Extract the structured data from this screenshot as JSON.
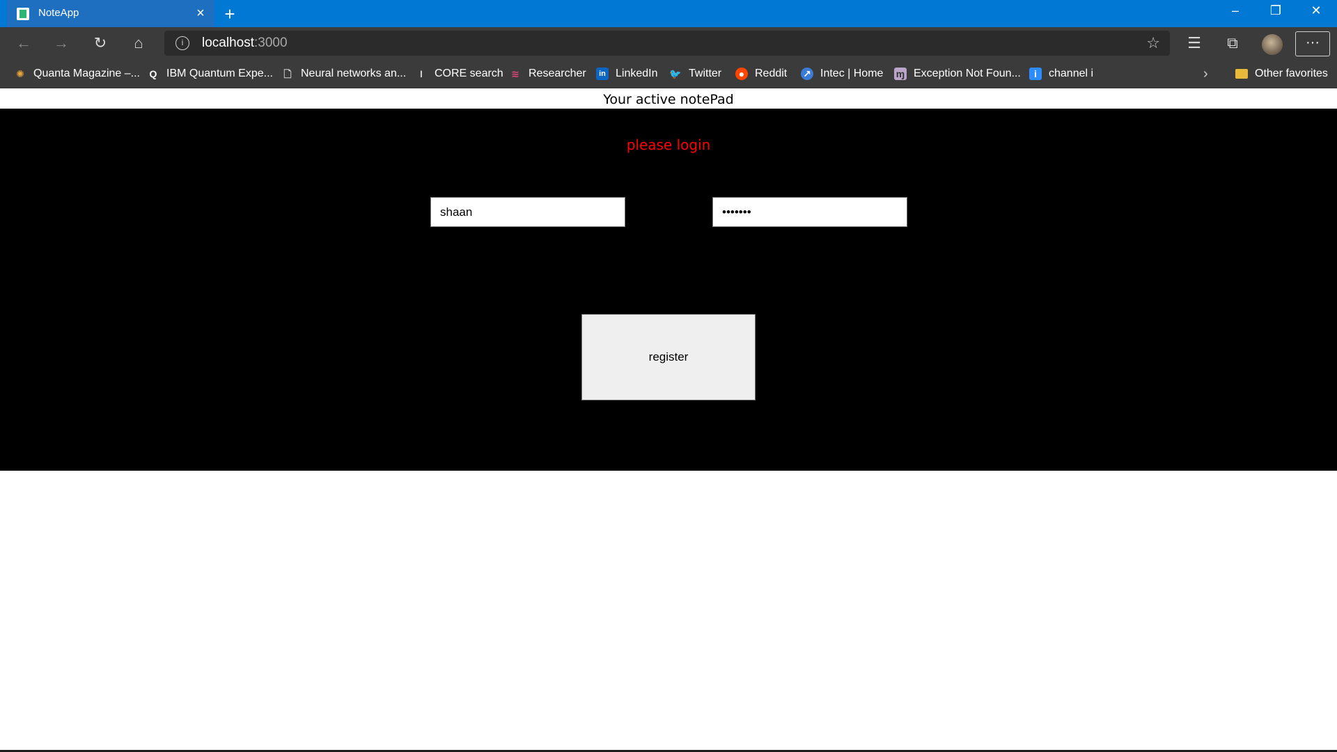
{
  "browser": {
    "tab_title": "NoteApp",
    "address": {
      "host": "localhost",
      "port": ":3000"
    },
    "favorites": [
      {
        "label": "Quanta Magazine –...",
        "icon": "quanta-icon",
        "color": "#e8a33a"
      },
      {
        "label": "IBM Quantum Expe...",
        "icon": "ibm-quantum-icon",
        "color": "#ffffff"
      },
      {
        "label": "Neural networks an...",
        "icon": "document-icon",
        "color": "#d0d0d0"
      },
      {
        "label": "CORE search",
        "icon": "core-icon",
        "color": "#d0d0d0"
      },
      {
        "label": "Researcher",
        "icon": "researcher-icon",
        "color": "#e0457b"
      },
      {
        "label": "LinkedIn",
        "icon": "linkedin-icon",
        "color": "#0a66c2"
      },
      {
        "label": "Twitter",
        "icon": "twitter-icon",
        "color": "#1da1f2"
      },
      {
        "label": "Reddit",
        "icon": "reddit-icon",
        "color": "#ff4500"
      },
      {
        "label": "Intec | Home",
        "icon": "intec-icon",
        "color": "#3a7bd5"
      },
      {
        "label": "Exception Not Foun...",
        "icon": "exception-icon",
        "color": "#b9a6c9"
      },
      {
        "label": "channel i",
        "icon": "channel-i-icon",
        "color": "#2d8cff"
      }
    ],
    "other_favorites": "Other favorites"
  },
  "page": {
    "header": "Your active notePad",
    "status": "please login",
    "username_value": "shaan",
    "password_value": "1234567",
    "register_label": "register"
  },
  "colors": {
    "titlebar": "#0078d4",
    "panel": "#000000",
    "status": "#ff0000"
  }
}
